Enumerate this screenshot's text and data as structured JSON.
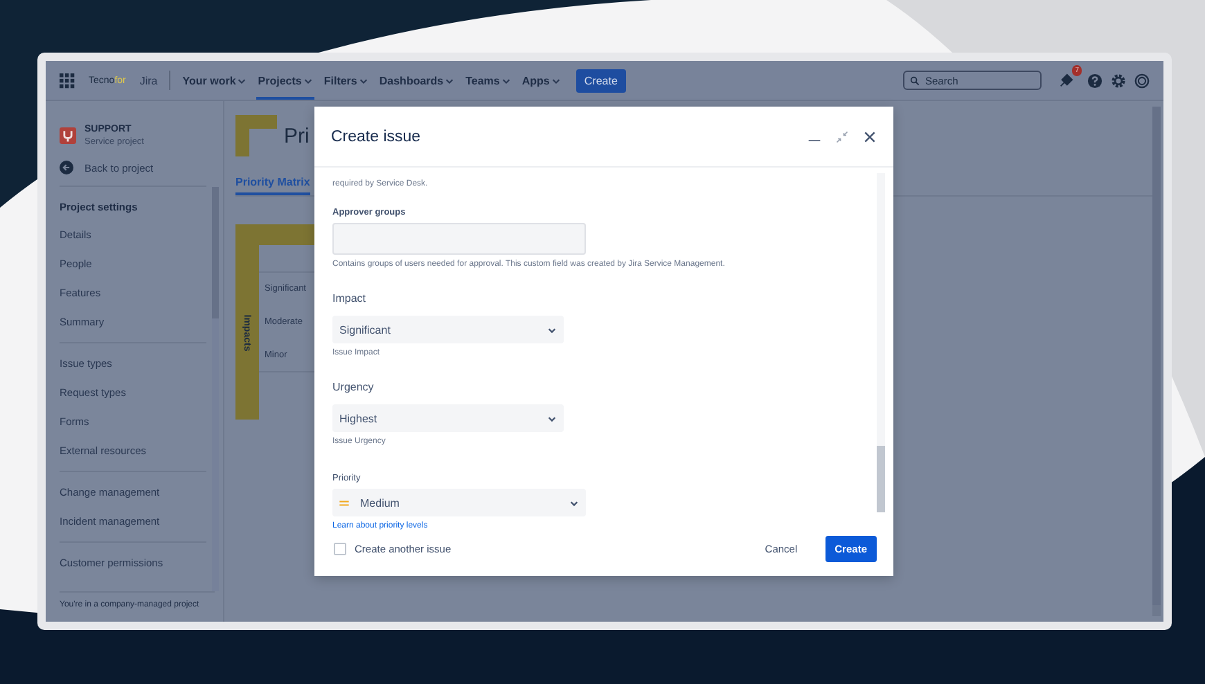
{
  "nav": {
    "logo_main": "Tecno",
    "logo_accent": "for",
    "product": "Jira",
    "items": [
      {
        "label": "Your work",
        "selected": false
      },
      {
        "label": "Projects",
        "selected": true
      },
      {
        "label": "Filters",
        "selected": false
      },
      {
        "label": "Dashboards",
        "selected": false
      },
      {
        "label": "Teams",
        "selected": false
      },
      {
        "label": "Apps",
        "selected": false
      }
    ],
    "create_button": "Create",
    "search": {
      "placeholder": "Search"
    },
    "notification_count": "7"
  },
  "sidebar": {
    "project_name": "SUPPORT",
    "project_type": "Service project",
    "back": "Back to project",
    "section_title": "Project settings",
    "groups": [
      [
        "Details",
        "People",
        "Features",
        "Summary"
      ],
      [
        "Issue types",
        "Request types",
        "Forms",
        "External resources"
      ],
      [
        "Change management",
        "Incident management"
      ],
      [
        "Customer permissions"
      ]
    ],
    "footer": "You're in a company-managed project"
  },
  "main": {
    "title": "Pri",
    "tabs": [
      {
        "label": "Priority Matrix",
        "selected": true
      }
    ],
    "matrix": {
      "axis_label": "Impacts",
      "rows": [
        "Significant",
        "Moderate",
        "Minor"
      ]
    }
  },
  "modal": {
    "title": "Create issue",
    "cut_note": "required by Service Desk.",
    "fields": [
      {
        "kind": "text",
        "label": "Approver groups",
        "help": "Contains groups of users needed for approval. This custom field was created by Jira Service Management."
      },
      {
        "kind": "select",
        "label": "Impact",
        "value": "Significant",
        "help": "Issue Impact"
      },
      {
        "kind": "select",
        "label": "Urgency",
        "value": "Highest",
        "help": "Issue Urgency"
      },
      {
        "kind": "priority",
        "label": "Priority",
        "value": "Medium",
        "link": "Learn about priority levels"
      }
    ],
    "create_another": {
      "label": "Create another issue",
      "checked": false
    },
    "cancel": "Cancel",
    "submit": "Create"
  }
}
